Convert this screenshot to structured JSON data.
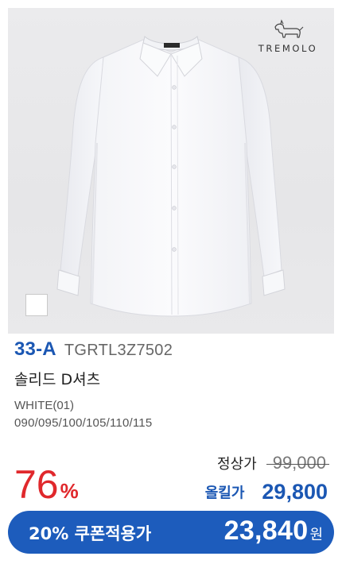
{
  "brand": {
    "name": "TREMOLO",
    "icon": "dachshund-dog-icon"
  },
  "product": {
    "image_icon": "white-dress-shirt-image",
    "code_tag": "33-A",
    "model_number": "TGRTL3Z7502",
    "name": "솔리드 D셔츠",
    "color": "WHITE(01)",
    "sizes": "090/095/100/105/110/115",
    "swatch_color": "#ffffff"
  },
  "pricing": {
    "discount_rate": "76",
    "discount_unit": "%",
    "regular_label": "정상가",
    "regular_price": "99,000",
    "sale_label": "올킬가",
    "sale_price": "29,800"
  },
  "coupon": {
    "label": "20% 쿠폰적용가",
    "price": "23,840",
    "unit": "원"
  },
  "colors": {
    "accent_blue": "#1d5cbc",
    "code_blue": "#1b57b3",
    "discount_red": "#e0282c"
  }
}
